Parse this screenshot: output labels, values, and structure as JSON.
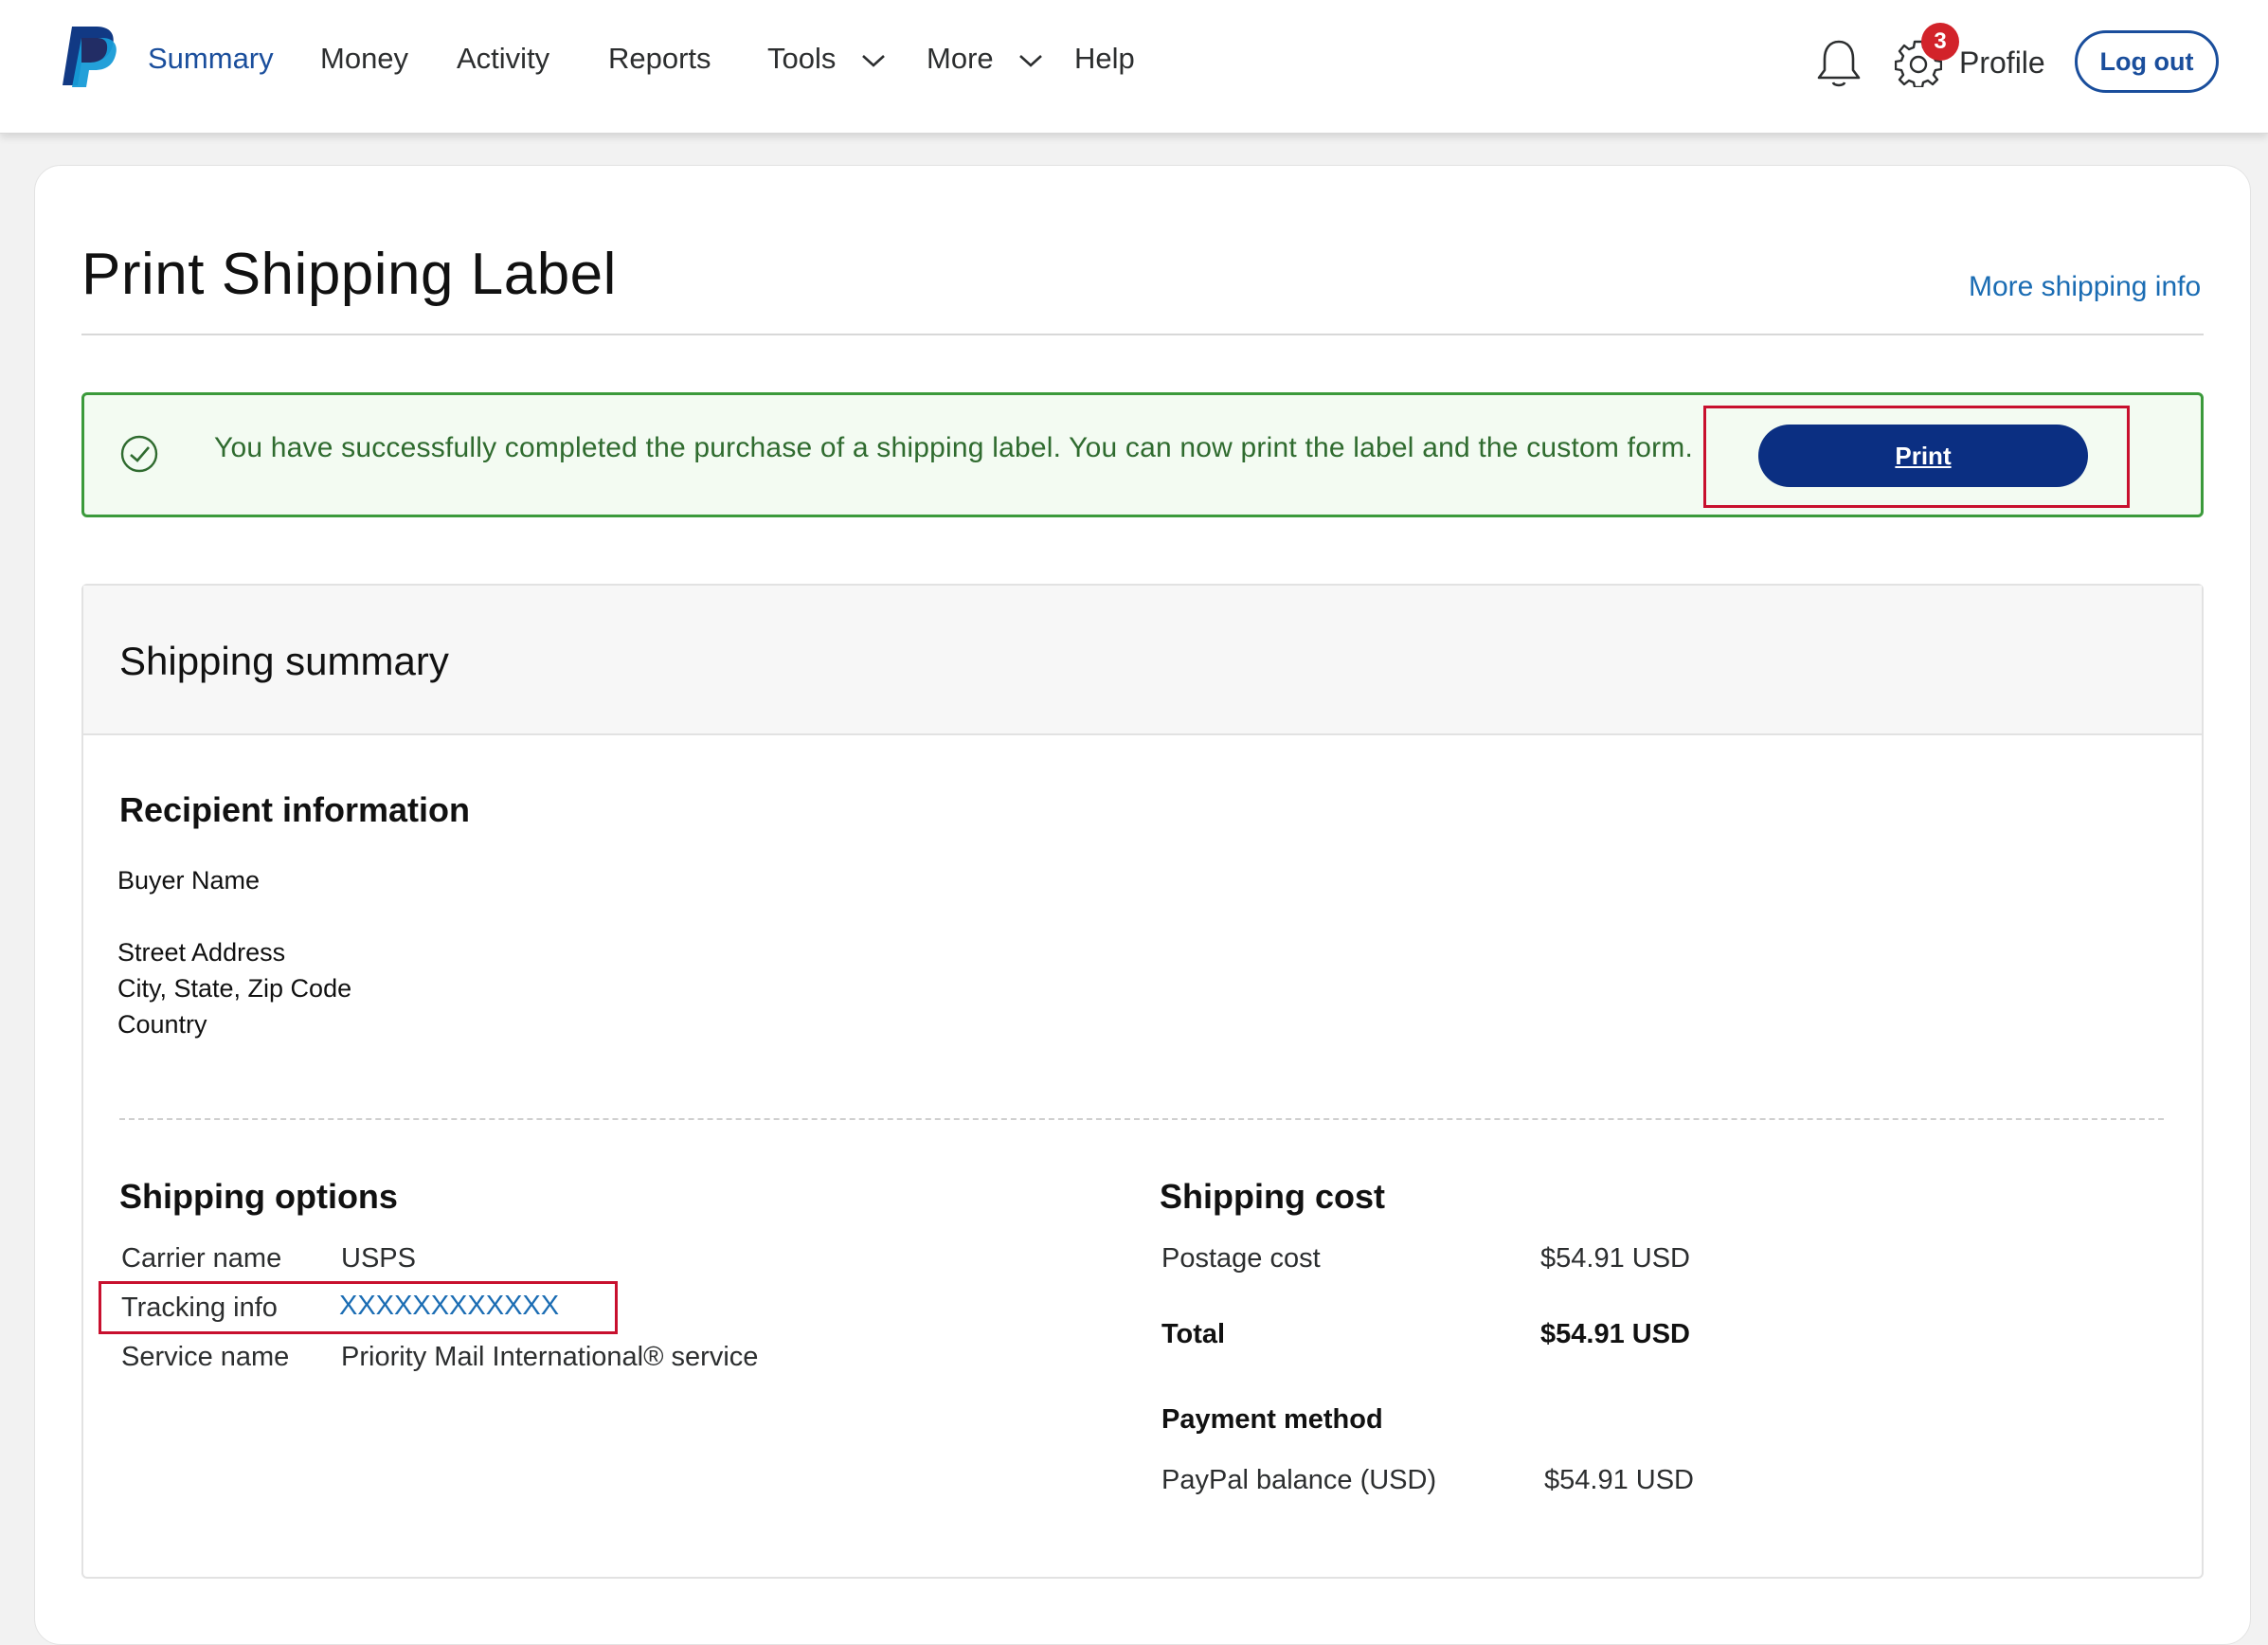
{
  "nav": {
    "items": [
      {
        "label": "Summary",
        "active": true
      },
      {
        "label": "Money"
      },
      {
        "label": "Activity"
      },
      {
        "label": "Reports"
      },
      {
        "label": "Tools"
      },
      {
        "label": "More"
      },
      {
        "label": "Help"
      }
    ],
    "notification_badge": "3",
    "profile_label": "Profile",
    "logout_label": "Log out",
    "icons": [
      "paypal-logo",
      "bell-icon",
      "gear-icon"
    ]
  },
  "page": {
    "title": "Print Shipping Label",
    "more_info_link": "More shipping info"
  },
  "banner": {
    "message": "You have successfully completed the purchase of a shipping label. You can now print the label and the custom form.",
    "print_label": "Print"
  },
  "summary": {
    "title": "Shipping summary",
    "recipient": {
      "heading": "Recipient information",
      "name": "Buyer Name",
      "street": "Street Address",
      "city": "City, State, Zip Code",
      "country": "Country"
    },
    "options": {
      "heading": "Shipping options",
      "carrier_label": "Carrier name",
      "carrier_value": "USPS",
      "tracking_label": "Tracking info",
      "tracking_value": "XXXXXXXXXXXX",
      "service_label": "Service name",
      "service_value": "Priority Mail International® service"
    },
    "cost": {
      "heading": "Shipping cost",
      "postage_label": "Postage cost",
      "postage_value": "$54.91 USD",
      "total_label": "Total",
      "total_value": "$54.91 USD",
      "payment_heading": "Payment method",
      "payment_label": "PayPal balance (USD)",
      "payment_value": "$54.91 USD"
    }
  },
  "colors": {
    "brand_blue": "#0b2f82",
    "link_blue": "#1a6cb3",
    "success_green": "#3b9a3b",
    "highlight_red": "#c8102e",
    "badge_red": "#d2232a"
  }
}
